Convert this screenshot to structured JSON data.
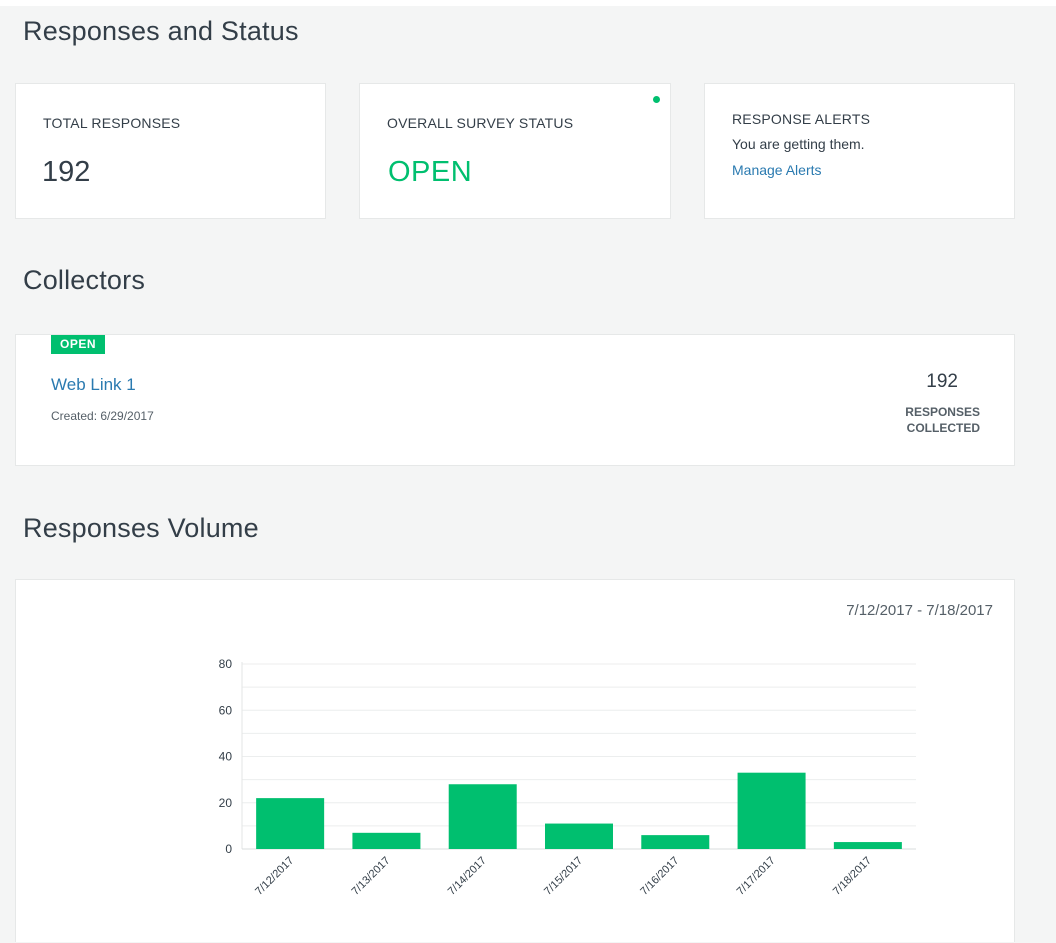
{
  "sections": {
    "status_title": "Responses and Status",
    "collectors_title": "Collectors",
    "volume_title": "Responses Volume"
  },
  "total_responses": {
    "label": "TOTAL RESPONSES",
    "value": "192"
  },
  "survey_status": {
    "label": "OVERALL SURVEY STATUS",
    "value": "OPEN",
    "status_color": "#00bf6f"
  },
  "response_alerts": {
    "label": "RESPONSE ALERTS",
    "text": "You are getting them.",
    "link": "Manage Alerts"
  },
  "collector": {
    "badge": "OPEN",
    "name": "Web Link 1",
    "created": "Created: 6/29/2017",
    "count": "192",
    "count_label": "RESPONSES COLLECTED"
  },
  "volume": {
    "date_range": "7/12/2017 - 7/18/2017"
  },
  "colors": {
    "accent_green": "#00bf6f",
    "link_blue": "#2a7ab0",
    "background": "#f4f5f5"
  },
  "chart_data": {
    "type": "bar",
    "categories": [
      "7/12/2017",
      "7/13/2017",
      "7/14/2017",
      "7/15/2017",
      "7/16/2017",
      "7/17/2017",
      "7/18/2017"
    ],
    "values": [
      22,
      7,
      28,
      11,
      6,
      33,
      3
    ],
    "yticks": [
      0,
      20,
      40,
      60,
      80
    ],
    "ylim": [
      0,
      80
    ],
    "grid": true,
    "bar_color": "#00bf6f"
  }
}
